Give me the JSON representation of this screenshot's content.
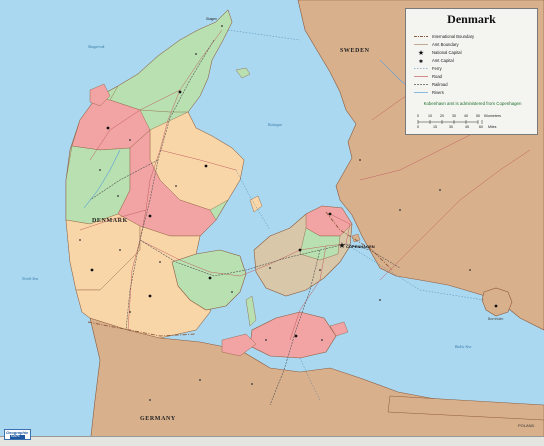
{
  "map": {
    "title": "Denmark",
    "colors": {
      "sea": "#a9d8f0",
      "land_foreign": "#d9b08c",
      "amt_green": "#b8e0b0",
      "amt_pink": "#f2a3a3",
      "amt_peach": "#f9d6a8",
      "amt_tan": "#d8c7a8",
      "border": "#8c5a3c",
      "road": "#c06060",
      "railroad": "#555555",
      "river": "#5aa0d8",
      "legend_note": "#1d6e2a"
    },
    "legend": {
      "items": [
        {
          "symbol": "international-boundary",
          "label": "International Boundary"
        },
        {
          "symbol": "amt-boundary",
          "label": "Amt Boundary"
        },
        {
          "symbol": "national-capital-star",
          "label": "National Capital"
        },
        {
          "symbol": "amt-capital-star",
          "label": "Amt Capital"
        },
        {
          "symbol": "ferry",
          "label": "Ferry"
        },
        {
          "symbol": "road",
          "label": "Road"
        },
        {
          "symbol": "railroad",
          "label": "Railroad"
        },
        {
          "symbol": "rivers",
          "label": "Rivers"
        }
      ],
      "note": "Kobenhavn amt is administered from Copenhagen",
      "scale": {
        "km_ticks": [
          "0",
          "10",
          "20",
          "30",
          "40",
          "50"
        ],
        "km_unit": "Kilometers",
        "mi_ticks": [
          "0",
          "15",
          "30",
          "45",
          "60"
        ],
        "mi_unit": "Miles"
      }
    },
    "labels": {
      "sweden": "SWEDEN",
      "denmark": "DENMARK",
      "germany": "GERMANY",
      "poland": "POLAND",
      "north_sea": "North Sea",
      "baltic_sea": "Baltic Sea",
      "skagerrak": "Skagerrak",
      "kattegat": "Kattegat",
      "copenhagen": "COPENHAGEN",
      "bornholm": "Bornholm",
      "skagen": "Skagen"
    },
    "brand": {
      "name": "Geographic",
      "sub": "MAPS"
    }
  }
}
